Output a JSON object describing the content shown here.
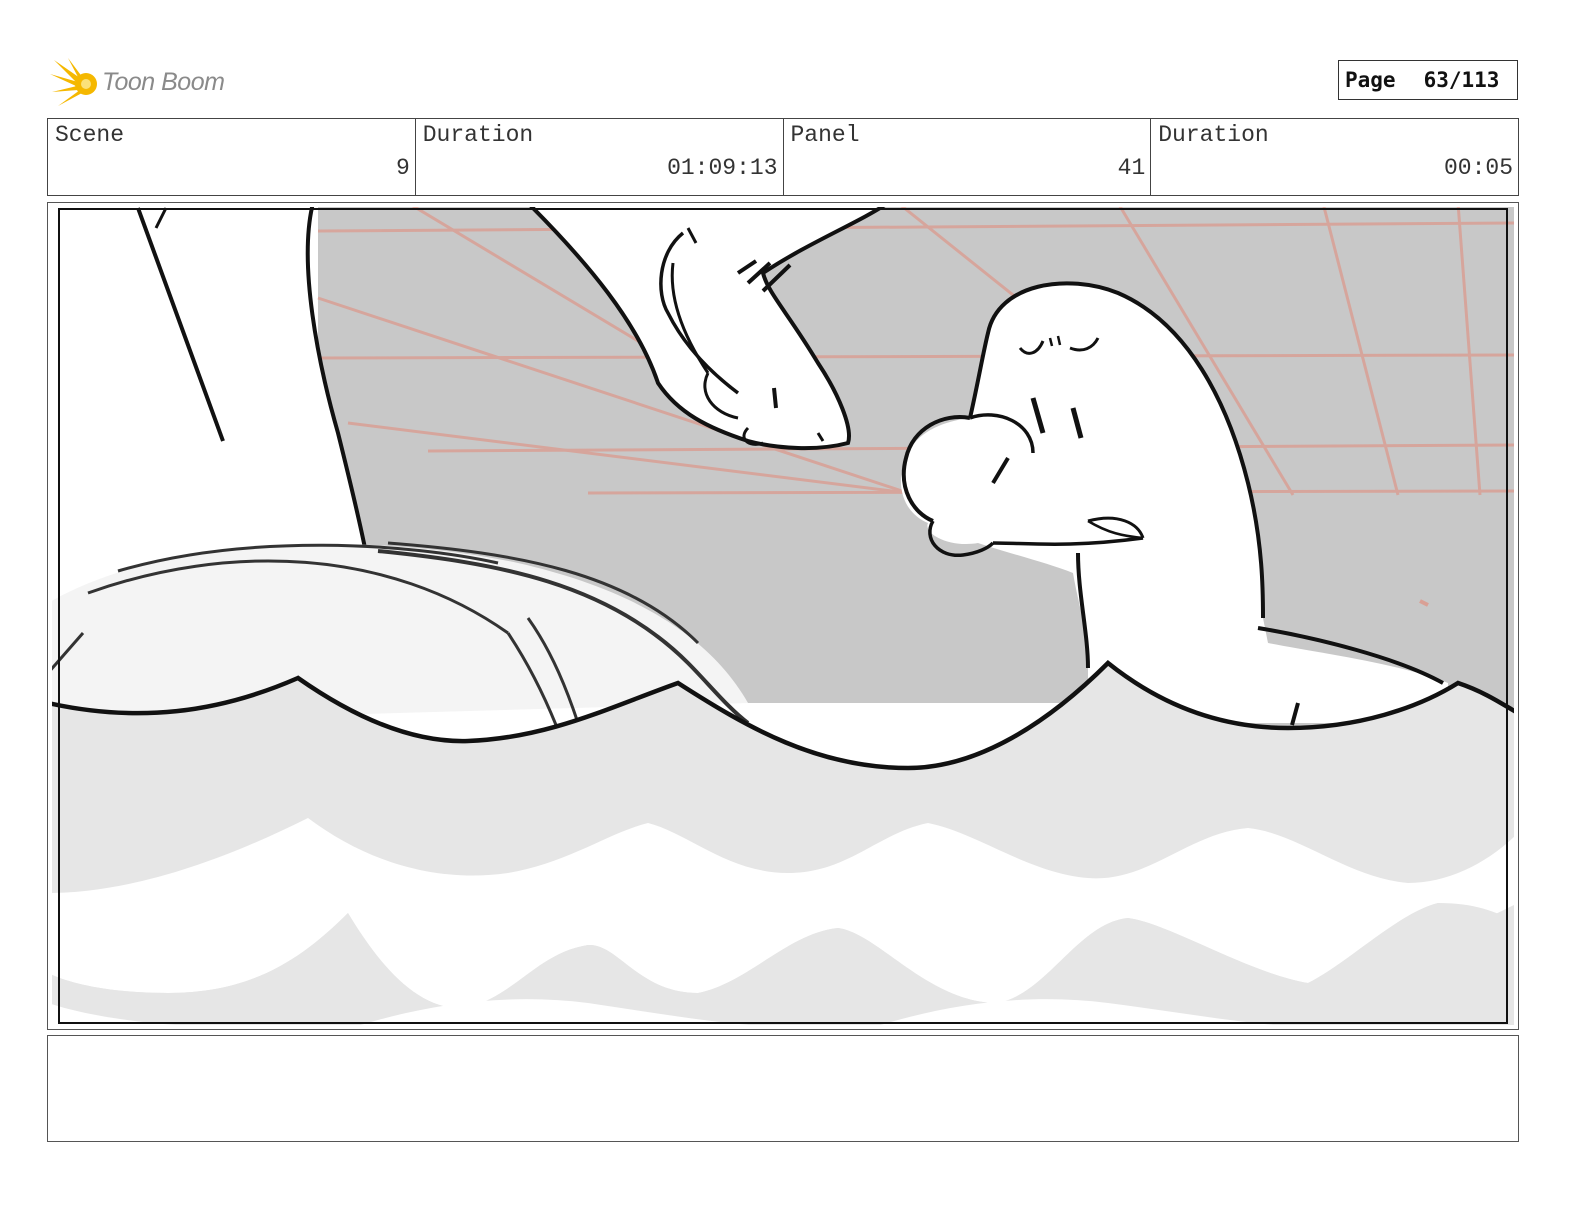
{
  "header": {
    "logo_text": "Toon Boom",
    "page_label": "Page",
    "page_value": "63/113"
  },
  "info": {
    "scene_label": "Scene",
    "scene_value": "9",
    "duration_label": "Duration",
    "duration_value": "01:09:13",
    "panel_label": "Panel",
    "panel_value": "41",
    "panel_duration_label": "Duration",
    "panel_duration_value": "00:05"
  },
  "colors": {
    "logo_accent": "#f5b800",
    "sky": "#c8c8c8",
    "perspective_lines": "#d9a095",
    "water_light": "#e6e6e6"
  },
  "notes": {
    "text": ""
  }
}
